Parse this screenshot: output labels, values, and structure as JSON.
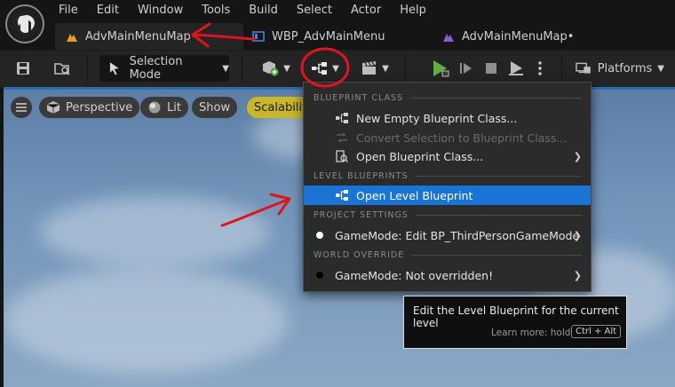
{
  "menubar": [
    "File",
    "Edit",
    "Window",
    "Tools",
    "Build",
    "Select",
    "Actor",
    "Help"
  ],
  "tabs": [
    {
      "label": "AdvMainMenuMap•",
      "icon": "level-map-icon",
      "active": true
    },
    {
      "label": "WBP_AdvMainMenu",
      "icon": "widget-blueprint-icon",
      "active": false
    },
    {
      "label": "AdvMainMenuMap•",
      "icon": "level-map-icon",
      "active": false
    }
  ],
  "toolbar": {
    "selection_mode": "Selection Mode",
    "platforms": "Platforms"
  },
  "viewport": {
    "perspective": "Perspective",
    "lit": "Lit",
    "show": "Show",
    "scalability": "Scalability"
  },
  "blueprint_menu": {
    "sections": {
      "blueprint_class": "BLUEPRINT CLASS",
      "level_blueprints": "LEVEL BLUEPRINTS",
      "project_settings": "PROJECT SETTINGS",
      "world_override": "WORLD OVERRIDE"
    },
    "items": {
      "new_empty": "New Empty Blueprint Class...",
      "convert": "Convert Selection to Blueprint Class...",
      "open_class": "Open Blueprint Class...",
      "open_level": "Open Level Blueprint",
      "gamemode_edit": "GameMode: Edit BP_ThirdPersonGameMode",
      "gamemode_override": "GameMode: Not overridden!"
    }
  },
  "tooltip": {
    "text": "Edit the Level Blueprint for the current level",
    "learn_more": "Learn more: hold",
    "shortcut": "Ctrl + Alt"
  },
  "colors": {
    "highlight": "#1a74d6",
    "annotation": "#e0141c",
    "play_green": "#5bb143",
    "scalability": "#c9b62a"
  }
}
